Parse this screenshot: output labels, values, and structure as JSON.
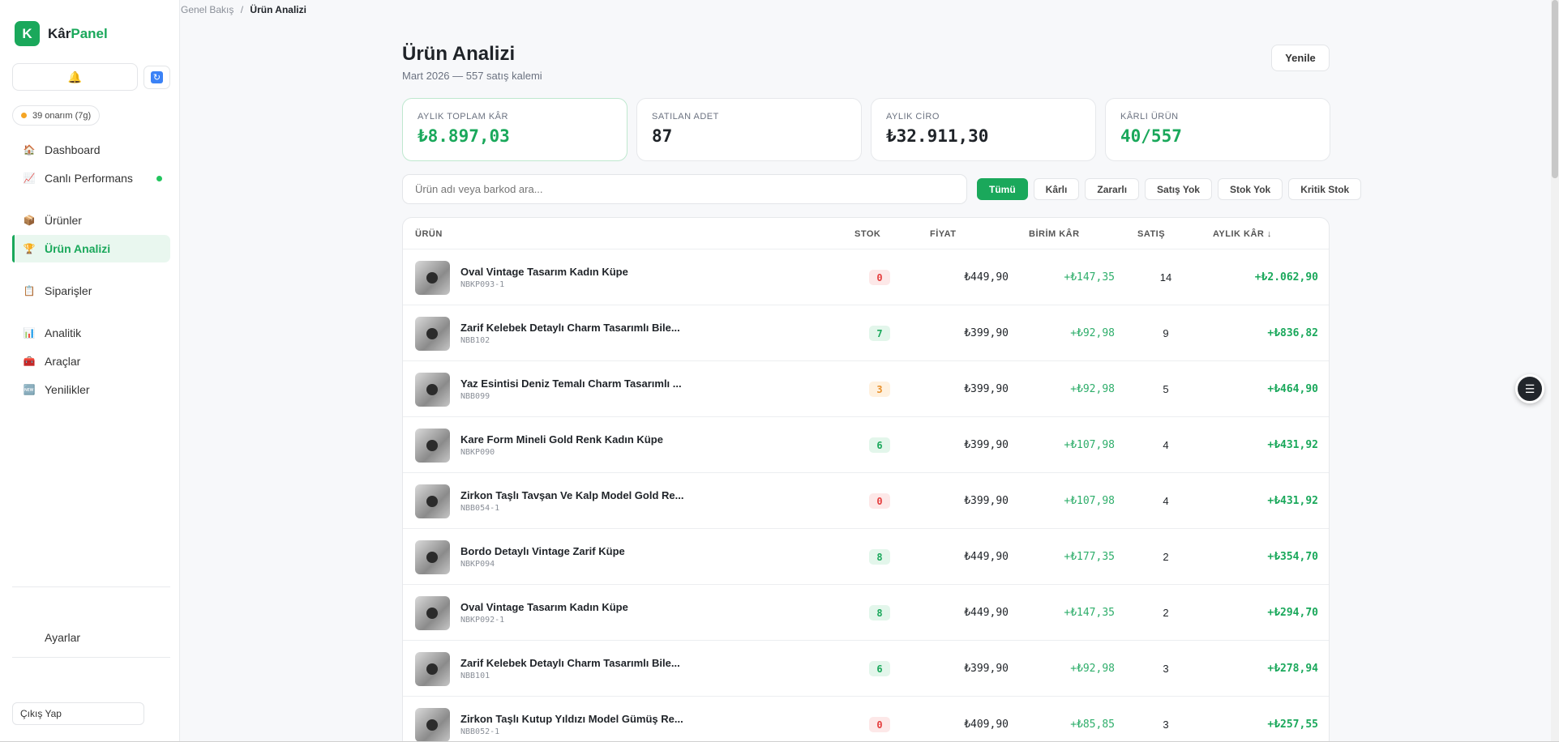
{
  "brand": {
    "logo_letter": "K",
    "name_part1": "Kâr",
    "name_part2": "Panel",
    "accent_color": "#1aa85b"
  },
  "sidebar": {
    "bell_icon": "🔔",
    "refresh_icon": "🔄",
    "approvals": "39 onarım (7g)",
    "items": [
      {
        "label": "Dashboard",
        "icon": "🏠"
      },
      {
        "label": "Canlı Performans",
        "icon": "📈"
      },
      {
        "label": "Ürünler",
        "icon": "📦"
      },
      {
        "label": "Ürün Analizi",
        "icon": "🏆"
      },
      {
        "label": "Siparişler",
        "icon": "📋"
      },
      {
        "label": "Analitik",
        "icon": "📊"
      },
      {
        "label": "Araçlar",
        "icon": "🧰"
      },
      {
        "label": "Yenilikler",
        "icon": "🆕"
      }
    ],
    "settings": "Ayarlar",
    "logout": "Çıkış Yap"
  },
  "breadcrumb": {
    "root": "Genel Bakış",
    "sep": "/",
    "current": "Ürün Analizi"
  },
  "header": {
    "title": "Ürün Analizi",
    "subtitle": "Mart 2026 — 557 satış kalemi",
    "refresh": "Yenile"
  },
  "stats": [
    {
      "label": "AYLIK TOPLAM KÂR",
      "value": "₺8.897,03"
    },
    {
      "label": "SATILAN ADET",
      "value": "87"
    },
    {
      "label": "AYLIK CİRO",
      "value": "₺32.911,30"
    },
    {
      "label": "KÂRLI ÜRÜN",
      "value": "40/557"
    }
  ],
  "search": {
    "placeholder": "Ürün adı veya barkod ara..."
  },
  "filters": [
    "Tümü",
    "Kârlı",
    "Zararlı",
    "Satış Yok",
    "Stok Yok",
    "Kritik Stok"
  ],
  "table": {
    "headers": {
      "product": "ÜRÜN",
      "stock": "STOK",
      "price": "FİYAT",
      "unit_profit": "BİRİM KÂR",
      "sales": "SATIŞ",
      "monthly_profit": "AYLIK KÂR ↓"
    },
    "rows": [
      {
        "name": "Oval Vintage Tasarım Kadın Küpe",
        "sku": "NBKP093-1",
        "stock": "0",
        "stock_status": "red",
        "price": "₺449,90",
        "unit": "+₺147,35",
        "sales": "14",
        "monthly": "+₺2.062,90"
      },
      {
        "name": "Zarif Kelebek Detaylı Charm Tasarımlı Bile...",
        "sku": "NBB102",
        "stock": "7",
        "stock_status": "green",
        "price": "₺399,90",
        "unit": "+₺92,98",
        "sales": "9",
        "monthly": "+₺836,82"
      },
      {
        "name": "Yaz Esintisi Deniz Temalı Charm Tasarımlı ...",
        "sku": "NBB099",
        "stock": "3",
        "stock_status": "orange",
        "price": "₺399,90",
        "unit": "+₺92,98",
        "sales": "5",
        "monthly": "+₺464,90"
      },
      {
        "name": "Kare Form Mineli Gold Renk Kadın Küpe",
        "sku": "NBKP090",
        "stock": "6",
        "stock_status": "green",
        "price": "₺399,90",
        "unit": "+₺107,98",
        "sales": "4",
        "monthly": "+₺431,92"
      },
      {
        "name": "Zirkon Taşlı Tavşan Ve Kalp Model Gold Re...",
        "sku": "NBB054-1",
        "stock": "0",
        "stock_status": "red",
        "price": "₺399,90",
        "unit": "+₺107,98",
        "sales": "4",
        "monthly": "+₺431,92"
      },
      {
        "name": "Bordo Detaylı Vintage Zarif Küpe",
        "sku": "NBKP094",
        "stock": "8",
        "stock_status": "green",
        "price": "₺449,90",
        "unit": "+₺177,35",
        "sales": "2",
        "monthly": "+₺354,70"
      },
      {
        "name": "Oval Vintage Tasarım Kadın Küpe",
        "sku": "NBKP092-1",
        "stock": "8",
        "stock_status": "green",
        "price": "₺449,90",
        "unit": "+₺147,35",
        "sales": "2",
        "monthly": "+₺294,70"
      },
      {
        "name": "Zarif Kelebek Detaylı Charm Tasarımlı Bile...",
        "sku": "NBB101",
        "stock": "6",
        "stock_status": "green",
        "price": "₺399,90",
        "unit": "+₺92,98",
        "sales": "3",
        "monthly": "+₺278,94"
      },
      {
        "name": "Zirkon Taşlı Kutup Yıldızı Model Gümüş Re...",
        "sku": "NBB052-1",
        "stock": "0",
        "stock_status": "red",
        "price": "₺409,90",
        "unit": "+₺85,85",
        "sales": "3",
        "monthly": "+₺257,55"
      }
    ]
  },
  "fab_icon": "☰"
}
